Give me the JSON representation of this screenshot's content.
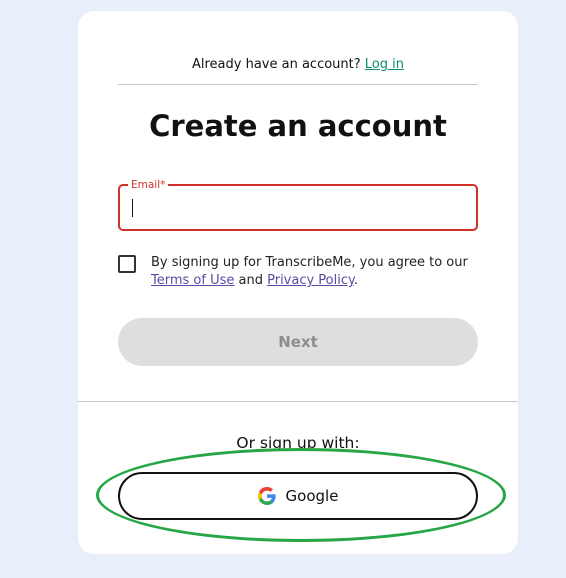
{
  "header": {
    "already_text": "Already have an account?",
    "login_link": "Log in"
  },
  "title": "Create an account",
  "email": {
    "label": "Email*",
    "value": "",
    "placeholder": ""
  },
  "terms": {
    "text_before": "By signing up for TranscribeMe, you agree to our ",
    "terms_link": "Terms of Use",
    "and_text": " and ",
    "privacy_link": "Privacy Policy",
    "period": "."
  },
  "next_button": "Next",
  "or_text": "Or sign up with:",
  "google_button": "Google",
  "colors": {
    "page_bg": "#e9eefb",
    "card_bg": "#ffffff",
    "login_link": "#108a73",
    "error_red": "#d0322a",
    "terms_link": "#5b4aa3",
    "disabled_button": "#dedede",
    "highlight_green": "#26a645"
  },
  "icons": {
    "google": "google-g-logo-icon",
    "checkbox": "checkbox-unchecked-icon"
  }
}
